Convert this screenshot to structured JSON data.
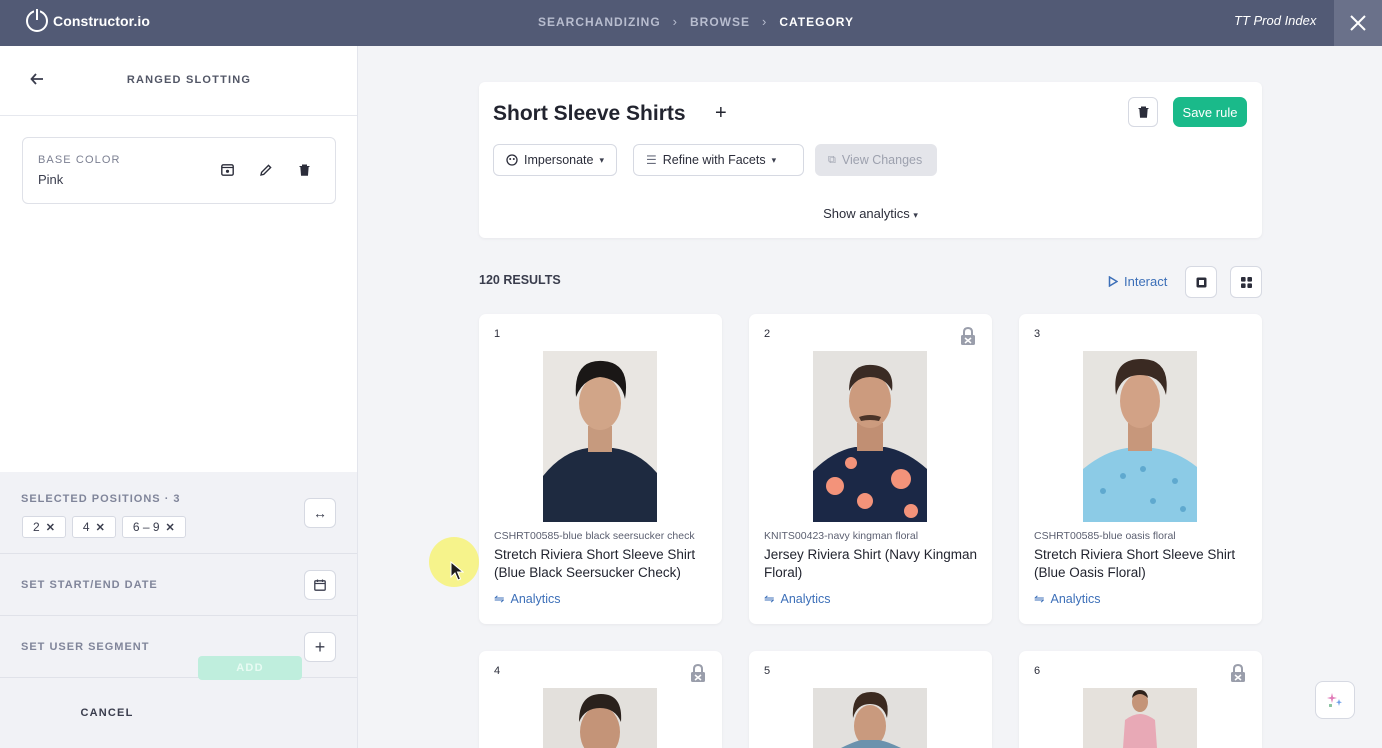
{
  "topbar": {
    "logo_text": "Constructor.io",
    "breadcrumbs": [
      "SEARCHANDIZING",
      "BROWSE",
      "CATEGORY"
    ],
    "index_name": "TT Prod Index"
  },
  "left_panel": {
    "title": "RANGED SLOTTING",
    "attribute": {
      "label": "BASE COLOR",
      "value": "Pink"
    },
    "selected_positions": {
      "label": "SELECTED POSITIONS",
      "count": "3",
      "chips": [
        "2",
        "4",
        "6 – 9"
      ]
    },
    "date_label": "SET START/END DATE",
    "segment_label": "SET USER SEGMENT",
    "cancel_label": "CANCEL",
    "add_label": "ADD"
  },
  "rule": {
    "title": "Short Sleeve Shirts",
    "save_label": "Save rule",
    "impersonate_label": "Impersonate",
    "facets_label": "Refine with Facets",
    "view_changes_label": "View Changes",
    "show_analytics_label": "Show analytics"
  },
  "results": {
    "count_label": "120 RESULTS",
    "interact_label": "Interact",
    "cards": [
      {
        "num": "1",
        "locked": false,
        "sku": "CSHRT00585-blue black seersucker check",
        "name": "Stretch Riviera Short Sleeve Shirt (Blue Black Seersucker Check)",
        "analytics": "Analytics"
      },
      {
        "num": "2",
        "locked": true,
        "sku": "KNITS00423-navy kingman floral",
        "name": "Jersey Riviera Shirt (Navy Kingman Floral)",
        "analytics": "Analytics"
      },
      {
        "num": "3",
        "locked": false,
        "sku": "CSHRT00585-blue oasis floral",
        "name": "Stretch Riviera Short Sleeve Shirt (Blue Oasis Floral)",
        "analytics": "Analytics"
      },
      {
        "num": "4",
        "locked": true
      },
      {
        "num": "5",
        "locked": false
      },
      {
        "num": "6",
        "locked": true
      }
    ]
  },
  "colors": {
    "topbar": "#525a75",
    "accent_green": "#1aba8a",
    "link_blue": "#3c6fb8"
  }
}
